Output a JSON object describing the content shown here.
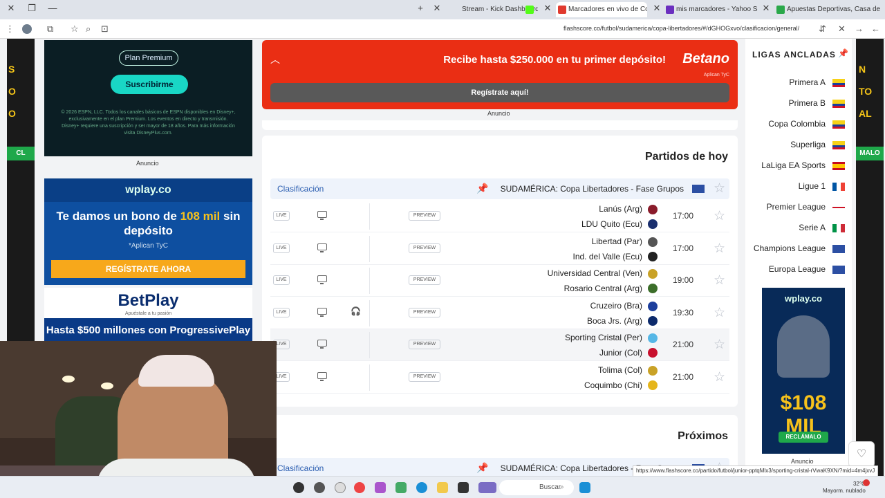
{
  "browser": {
    "tabs": [
      {
        "label": "Apuestas Deportivas, Casa de",
        "color": "#2aa84a"
      },
      {
        "label": "mis marcadores - Yahoo Search",
        "color": "#6b2fbf"
      },
      {
        "label": "Marcadores en vivo de Copa L",
        "color": "#e03a2f"
      },
      {
        "label": "Stream - Kick Dashboard",
        "color": "#53fc18"
      }
    ],
    "url": "flashscore.co/futbol/sudamerica/copa-libertadores/#/dGHOGxvo/clasificacion/general/"
  },
  "left_ads": {
    "ad1_pill": "Plan Premium",
    "ad1_button": "Suscribirme",
    "ad1_fine": "© 2026 ESPN, LLC. Todos los canales básicos de ESPN disponibles en Disney+, exclusivamente en el plan Premium. Los eventos en directo y transmisión. Disney+ requiere una suscripción y ser mayor de 18 años. Para más información visita DisneyPlus.com.",
    "ad1_label": "Anuncio",
    "ad2_brand": "wplay.co",
    "ad2_headline_a": "Te damos un bono de",
    "ad2_headline_hl": "108 mil",
    "ad2_headline_b": "sin depósito",
    "ad2_sub": "*Aplican TyC",
    "ad2_button": "REGÍSTRATE AHORA",
    "ad3_brand": "BetPlay",
    "ad3_tag": "Apuéstale a tu pasión",
    "ad3_band": "Hasta $500 millones con ProgressivePlay"
  },
  "promo": {
    "logo": "Betano",
    "text": "Recibe hasta $250.000 en tu primer depósito!",
    "tyc": "Aplican TyC",
    "button": "Regístrate aquí!",
    "label": "Anuncio"
  },
  "today": {
    "title": "Partidos de hoy",
    "league": "SUDAMÉRICA: Copa Libertadores - Fase Grupos",
    "clasificacion": "Clasificación",
    "preview_label": "PREVIEW",
    "live_label": "LIVE",
    "matches": [
      {
        "time": "17:00",
        "home": "Lanús (Arg)",
        "away": "LDU Quito (Ecu)",
        "home_color": "#8a1c2b",
        "away_color": "#1a2f6e"
      },
      {
        "time": "17:00",
        "home": "Libertad (Par)",
        "away": "Ind. del Valle (Ecu)",
        "home_color": "#555555",
        "away_color": "#222222"
      },
      {
        "time": "19:00",
        "home": "Universidad Central (Ven)",
        "away": "Rosario Central (Arg)",
        "home_color": "#c9a227",
        "away_color": "#3c6e2a"
      },
      {
        "time": "19:30",
        "home": "Cruzeiro (Bra)",
        "away": "Boca Jrs. (Arg)",
        "home_color": "#1d3f9c",
        "away_color": "#0c2a6b"
      },
      {
        "time": "21:00",
        "home": "Sporting Cristal (Per)",
        "away": "Junior (Col)",
        "home_color": "#56b7e6",
        "away_color": "#c8102e"
      },
      {
        "time": "21:00",
        "home": "Tolima (Col)",
        "away": "Coquimbo (Chi)",
        "home_color": "#c9a227",
        "away_color": "#e5b51b"
      }
    ]
  },
  "upcoming": {
    "title": "Próximos",
    "league": "SUDAMÉRICA: Copa Libertadores - Fase Grupos",
    "clasificacion": "Clasificación"
  },
  "pinned": {
    "title": "LIGAS ANCLADAS",
    "items": [
      {
        "label": "Primera A",
        "flag": "col"
      },
      {
        "label": "Primera B",
        "flag": "col"
      },
      {
        "label": "Copa Colombia",
        "flag": "col"
      },
      {
        "label": "Superliga",
        "flag": "col"
      },
      {
        "label": "LaLiga EA Sports",
        "flag": "esp"
      },
      {
        "label": "Ligue 1",
        "flag": "fra"
      },
      {
        "label": "Premier League",
        "flag": "eng"
      },
      {
        "label": "Serie A",
        "flag": "ita"
      },
      {
        "label": "Champions League",
        "flag": "eu"
      },
      {
        "label": "Europa League",
        "flag": "eu"
      }
    ],
    "ad_brand": "wplay.co",
    "ad_big": "$108 MIL",
    "ad_button": "RECLÁMALO",
    "ad_label": "Anuncio"
  },
  "status_link": "https://www.flashscore.co/partido/futbol/junior-pptqMlx3/sporting-cristal-rVwaK9XN/?mid=4m4jxvJ",
  "taskbar": {
    "search": "Buscar",
    "temp": "32°C",
    "weather": "Mayorm. nublado"
  }
}
